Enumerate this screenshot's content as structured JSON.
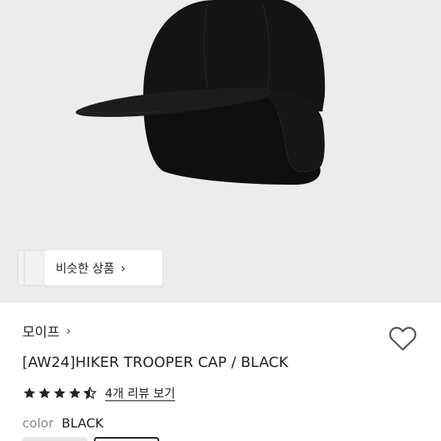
{
  "product": {
    "image_alt": "HIKER TROOPER CAP black",
    "similar_button_label": "비슷한 상품",
    "brand": "모이프",
    "title": "[AW24]HIKER TROOPER CAP / BLACK",
    "rating": 4.5,
    "review_label": "4개 리뷰 보기",
    "color_label": "color",
    "color_value": "BLACK"
  },
  "icons": {
    "chevron": "chevron-right-icon",
    "heart": "heart-outline-icon",
    "star": "star-icon"
  },
  "colors": {
    "hero_bg": "#ececec",
    "text": "#222222",
    "muted": "#888888",
    "cap": "#111111"
  }
}
